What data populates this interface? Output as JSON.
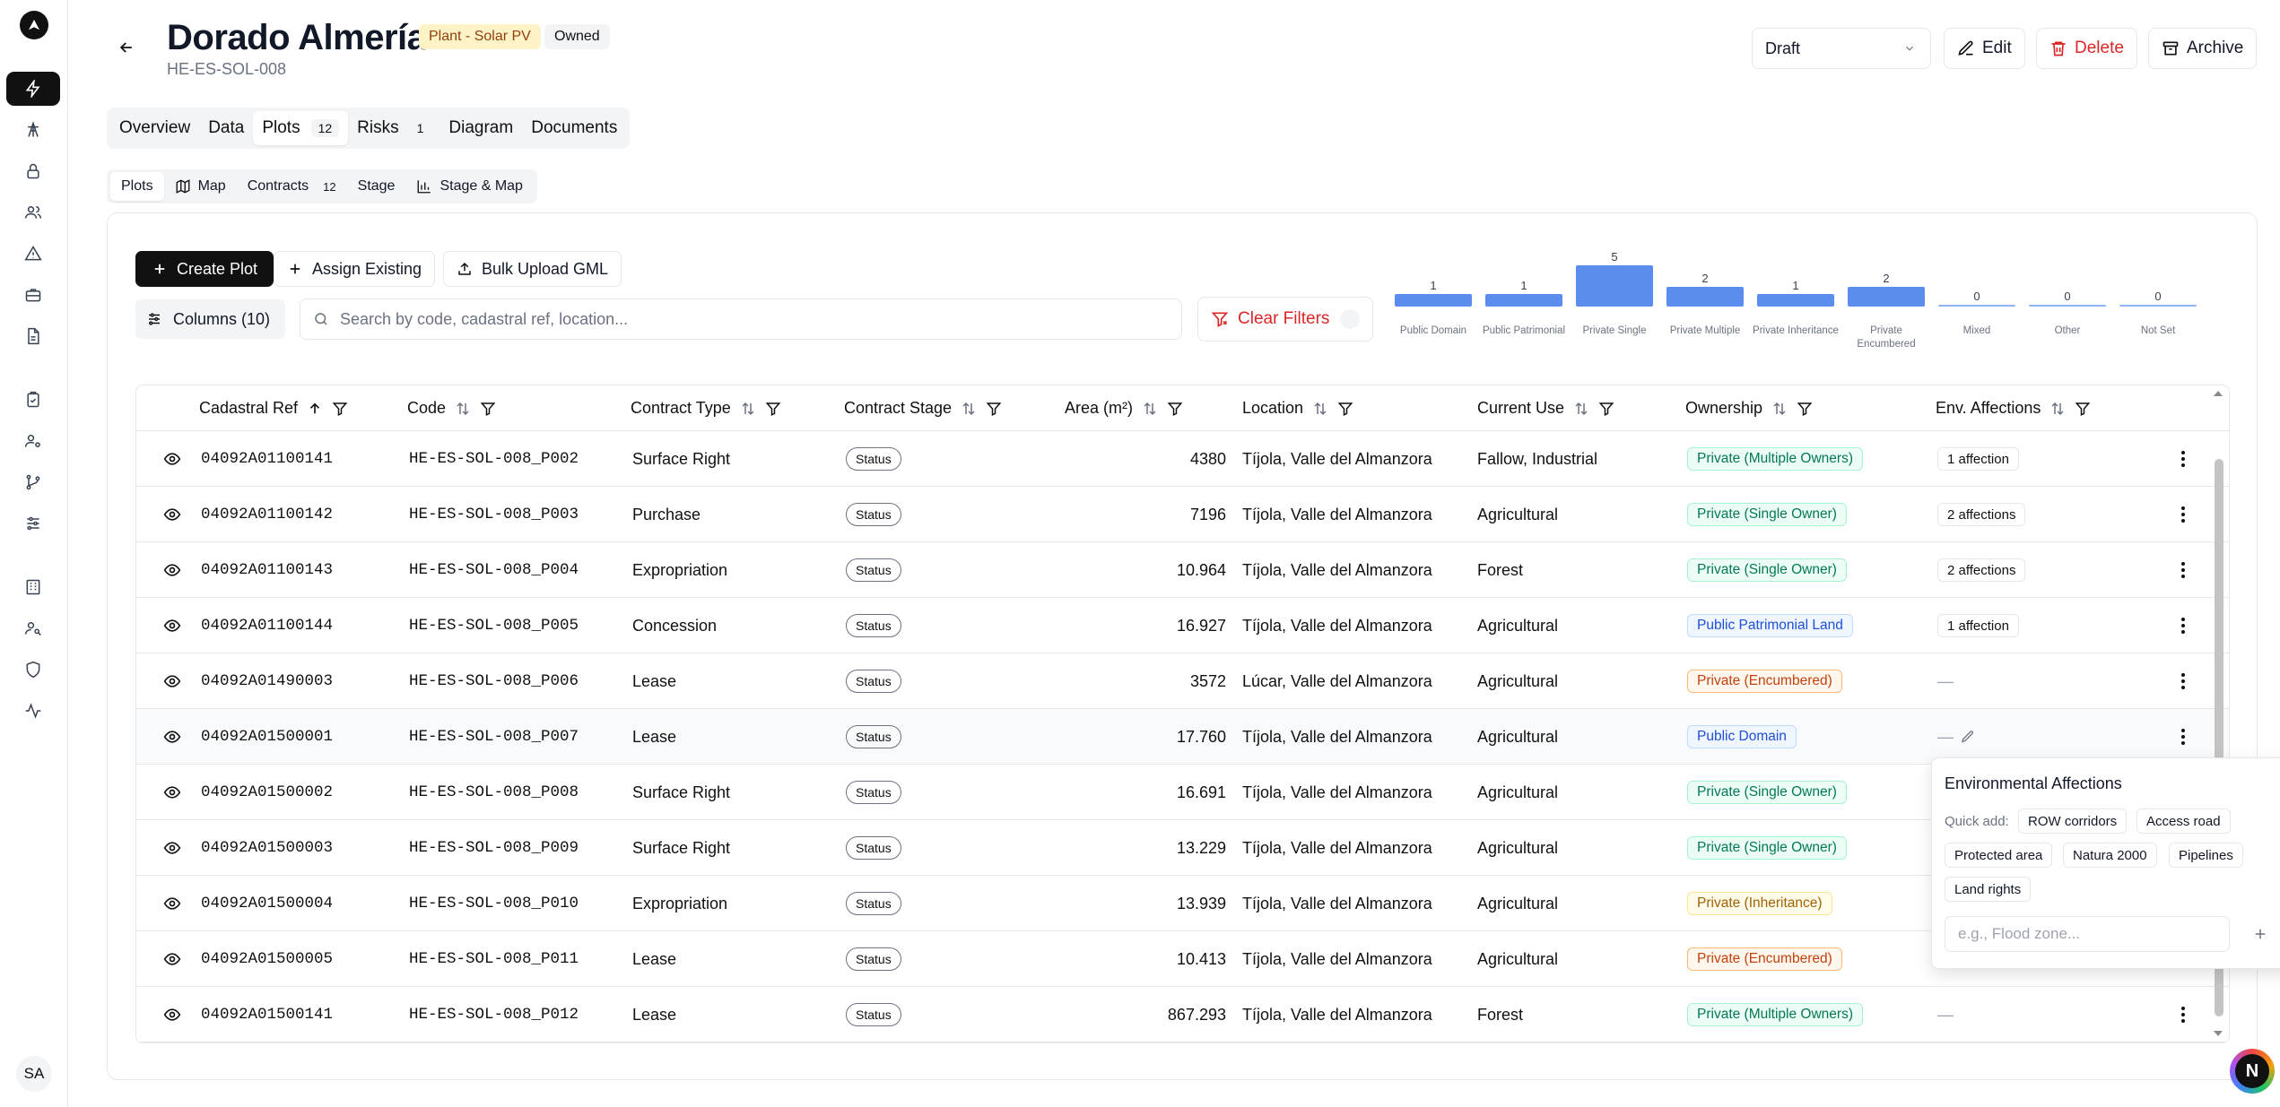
{
  "user_initials": "SA",
  "header": {
    "title": "Dorado Almería",
    "type_badge": "Plant - Solar PV",
    "owned_badge": "Owned",
    "subtitle": "HE-ES-SOL-008",
    "status_value": "Draft",
    "edit_label": "Edit",
    "delete_label": "Delete",
    "archive_label": "Archive"
  },
  "tabs": [
    {
      "label": "Overview",
      "count": ""
    },
    {
      "label": "Data",
      "count": ""
    },
    {
      "label": "Plots",
      "count": "12"
    },
    {
      "label": "Risks",
      "count": "1"
    },
    {
      "label": "Diagram",
      "count": ""
    },
    {
      "label": "Documents",
      "count": ""
    }
  ],
  "subtabs": [
    {
      "label": "Plots",
      "count": ""
    },
    {
      "label": "Map",
      "count": ""
    },
    {
      "label": "Contracts",
      "count": "12"
    },
    {
      "label": "Stage",
      "count": ""
    },
    {
      "label": "Stage & Map",
      "count": ""
    }
  ],
  "toolbar": {
    "create_label": "Create Plot",
    "assign_label": "Assign Existing",
    "bulk_label": "Bulk Upload GML",
    "columns_label": "Columns (10)",
    "search_placeholder": "Search by code, cadastral ref, location...",
    "clear_label": "Clear Filters"
  },
  "chart_data": {
    "type": "bar",
    "categories": [
      "Public Domain",
      "Public Patrimonial",
      "Private Single",
      "Private Multiple",
      "Private Inheritance",
      "Private Encumbered",
      "Mixed",
      "Other",
      "Not Set"
    ],
    "values": [
      1,
      1,
      5,
      2,
      1,
      2,
      0,
      0,
      0
    ]
  },
  "columns": [
    "Cadastral Ref",
    "Code",
    "Contract Type",
    "Contract Stage",
    "Area (m²)",
    "Location",
    "Current Use",
    "Ownership",
    "Env. Affections"
  ],
  "rows": [
    {
      "cadastral": "04092A01100141",
      "code": "HE-ES-SOL-008_P002",
      "contract": "Surface Right",
      "stage": "Status",
      "area": "4380",
      "location": "Tíjola, Valle del Almanzora",
      "use": "Fallow, Industrial",
      "ownership": "Private (Multiple Owners)",
      "own_color": "green",
      "aff": "1 affection"
    },
    {
      "cadastral": "04092A01100142",
      "code": "HE-ES-SOL-008_P003",
      "contract": "Purchase",
      "stage": "Status",
      "area": "7196",
      "location": "Tíjola, Valle del Almanzora",
      "use": "Agricultural",
      "ownership": "Private (Single Owner)",
      "own_color": "green",
      "aff": "2 affections"
    },
    {
      "cadastral": "04092A01100143",
      "code": "HE-ES-SOL-008_P004",
      "contract": "Expropriation",
      "stage": "Status",
      "area": "10.964",
      "location": "Tíjola, Valle del Almanzora",
      "use": "Forest",
      "ownership": "Private (Single Owner)",
      "own_color": "green",
      "aff": "2 affections"
    },
    {
      "cadastral": "04092A01100144",
      "code": "HE-ES-SOL-008_P005",
      "contract": "Concession",
      "stage": "Status",
      "area": "16.927",
      "location": "Tíjola, Valle del Almanzora",
      "use": "Agricultural",
      "ownership": "Public Patrimonial Land",
      "own_color": "blue",
      "aff": "1 affection"
    },
    {
      "cadastral": "04092A01490003",
      "code": "HE-ES-SOL-008_P006",
      "contract": "Lease",
      "stage": "Status",
      "area": "3572",
      "location": "Lúcar, Valle del Almanzora",
      "use": "Agricultural",
      "ownership": "Private (Encumbered)",
      "own_color": "orange",
      "aff": "—"
    },
    {
      "cadastral": "04092A01500001",
      "code": "HE-ES-SOL-008_P007",
      "contract": "Lease",
      "stage": "Status",
      "area": "17.760",
      "location": "Tíjola, Valle del Almanzora",
      "use": "Agricultural",
      "ownership": "Public Domain",
      "own_color": "blue",
      "aff": "—"
    },
    {
      "cadastral": "04092A01500002",
      "code": "HE-ES-SOL-008_P008",
      "contract": "Surface Right",
      "stage": "Status",
      "area": "16.691",
      "location": "Tíjola, Valle del Almanzora",
      "use": "Agricultural",
      "ownership": "Private (Single Owner)",
      "own_color": "green",
      "aff": ""
    },
    {
      "cadastral": "04092A01500003",
      "code": "HE-ES-SOL-008_P009",
      "contract": "Surface Right",
      "stage": "Status",
      "area": "13.229",
      "location": "Tíjola, Valle del Almanzora",
      "use": "Agricultural",
      "ownership": "Private (Single Owner)",
      "own_color": "green",
      "aff": ""
    },
    {
      "cadastral": "04092A01500004",
      "code": "HE-ES-SOL-008_P010",
      "contract": "Expropriation",
      "stage": "Status",
      "area": "13.939",
      "location": "Tíjola, Valle del Almanzora",
      "use": "Agricultural",
      "ownership": "Private (Inheritance)",
      "own_color": "yellow",
      "aff": ""
    },
    {
      "cadastral": "04092A01500005",
      "code": "HE-ES-SOL-008_P011",
      "contract": "Lease",
      "stage": "Status",
      "area": "10.413",
      "location": "Tíjola, Valle del Almanzora",
      "use": "Agricultural",
      "ownership": "Private (Encumbered)",
      "own_color": "orange",
      "aff": ""
    },
    {
      "cadastral": "04092A01500141",
      "code": "HE-ES-SOL-008_P012",
      "contract": "Lease",
      "stage": "Status",
      "area": "867.293",
      "location": "Tíjola, Valle del Almanzora",
      "use": "Forest",
      "ownership": "Private (Multiple Owners)",
      "own_color": "green",
      "aff": "—"
    }
  ],
  "popover": {
    "title": "Environmental Affections",
    "quick_label": "Quick add:",
    "chips": [
      "ROW corridors",
      "Access road",
      "Protected area",
      "Natura 2000",
      "Pipelines",
      "Land rights"
    ],
    "input_placeholder": "e.g., Flood zone..."
  },
  "fab_label": "N"
}
